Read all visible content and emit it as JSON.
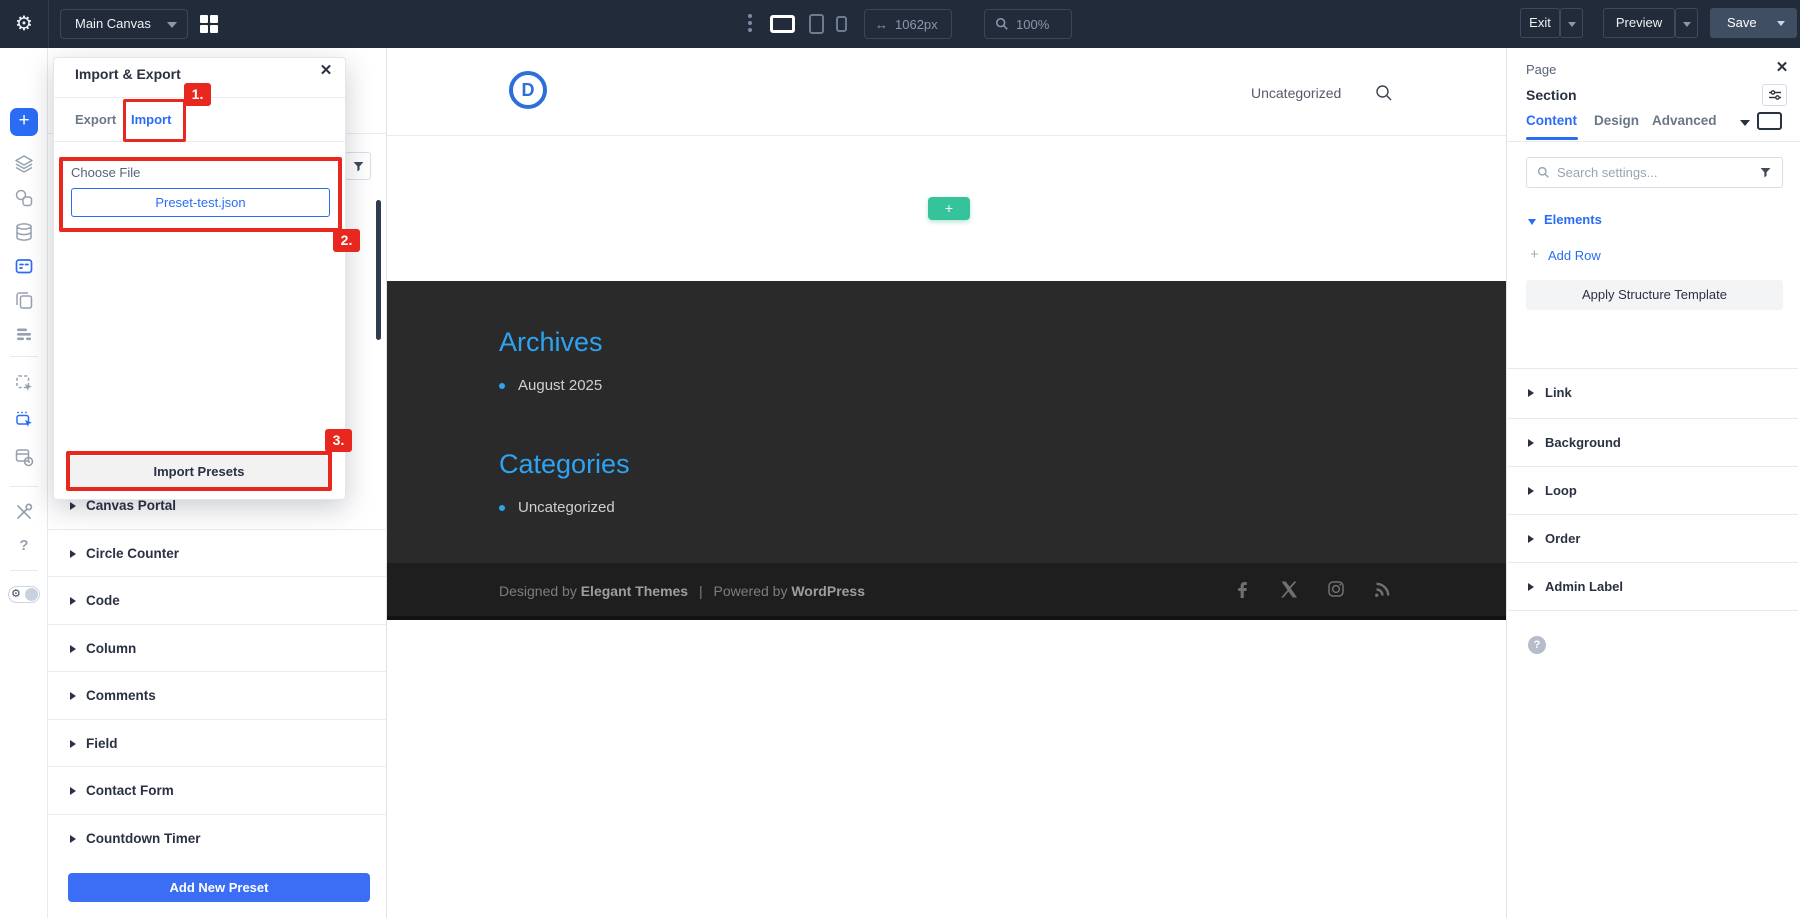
{
  "toolbar": {
    "canvas_selector": "Main Canvas",
    "width_value": "1062px",
    "zoom_value": "100%",
    "exit_label": "Exit",
    "preview_label": "Preview",
    "save_label": "Save"
  },
  "modal": {
    "title": "Import & Export",
    "tabs": {
      "export": "Export",
      "import": "Import"
    },
    "choose_file_label": "Choose File",
    "file_name": "Preset-test.json",
    "import_button": "Import Presets",
    "annotations": {
      "step1": "1.",
      "step2": "2.",
      "step3": "3."
    }
  },
  "preset_panel": {
    "items": [
      "Canvas Portal",
      "Circle Counter",
      "Code",
      "Column",
      "Comments",
      "Field",
      "Contact Form",
      "Countdown Timer"
    ],
    "add_button": "Add New Preset"
  },
  "canvas": {
    "logo_letter": "D",
    "menu_item": "Uncategorized",
    "add_section_label": "+",
    "sidebar": {
      "archives_title": "Archives",
      "archives_items": [
        "August 2025"
      ],
      "categories_title": "Categories",
      "categories_items": [
        "Uncategorized"
      ]
    },
    "footer": {
      "designed_by": "Designed by",
      "designer": "Elegant Themes",
      "separator": "|",
      "powered_by": "Powered by",
      "platform": "WordPress"
    }
  },
  "right_panel": {
    "title": "Page",
    "subtitle": "Section",
    "tabs": [
      "Content",
      "Design",
      "Advanced"
    ],
    "search_placeholder": "Search settings...",
    "elements_header": "Elements",
    "add_row": "Add Row",
    "apply_structure": "Apply Structure Template",
    "accordions": [
      "Link",
      "Background",
      "Loop",
      "Order",
      "Admin Label"
    ]
  },
  "icons": {
    "gear": "⚙",
    "close": "✕",
    "help": "?",
    "plus": "+",
    "width_arrows": "↔"
  },
  "colors": {
    "topbar_bg": "#222b3a",
    "accent_blue": "#2a6df4",
    "annotation_red": "#e8281e",
    "add_section_green": "#35c39c",
    "site_link_blue": "#2ea3f2",
    "site_dark_section": "#2a2a2a",
    "site_footer": "#1e1e1e"
  }
}
